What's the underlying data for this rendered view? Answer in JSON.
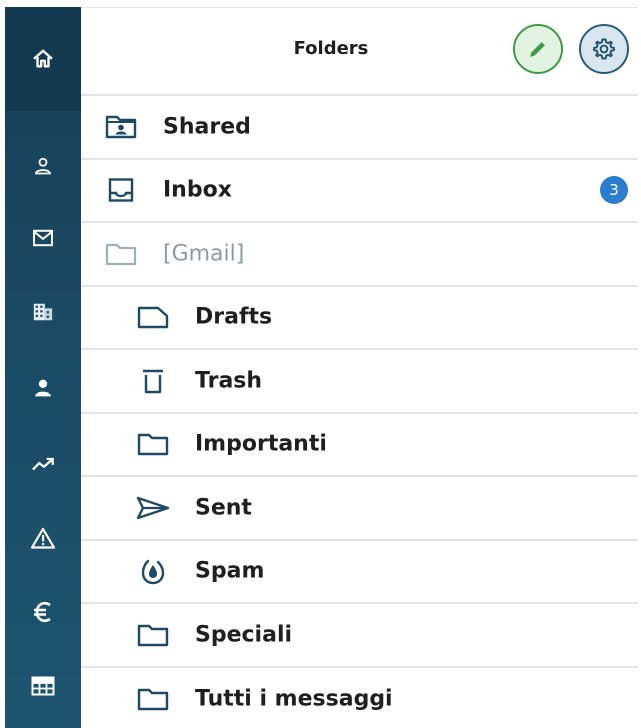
{
  "rail": {
    "items": [
      {
        "name": "home-icon"
      },
      {
        "name": "user-icon"
      },
      {
        "name": "mail-icon"
      },
      {
        "name": "building-icon"
      },
      {
        "name": "person-icon"
      },
      {
        "name": "trending-up-icon"
      },
      {
        "name": "warning-icon"
      },
      {
        "name": "euro-icon"
      },
      {
        "name": "table-icon"
      }
    ]
  },
  "header": {
    "title": "Folders",
    "edit_icon": "pencil-icon",
    "settings_icon": "gear-icon"
  },
  "folders": [
    {
      "label": "Shared",
      "icon": "shared-folder-icon",
      "level": 0
    },
    {
      "label": "Inbox",
      "icon": "inbox-icon",
      "level": 0,
      "badge": "3"
    },
    {
      "label": "[Gmail]",
      "icon": "folder-icon",
      "level": 0,
      "muted": true
    },
    {
      "label": "Drafts",
      "icon": "drafts-icon",
      "level": 1
    },
    {
      "label": "Trash",
      "icon": "trash-icon",
      "level": 1
    },
    {
      "label": "Importanti",
      "icon": "folder-icon",
      "level": 1
    },
    {
      "label": "Sent",
      "icon": "send-icon",
      "level": 1
    },
    {
      "label": "Spam",
      "icon": "spam-icon",
      "level": 1
    },
    {
      "label": "Speciali",
      "icon": "folder-icon",
      "level": 1
    },
    {
      "label": "Tutti i messaggi",
      "icon": "folder-icon",
      "level": 1
    }
  ],
  "colors": {
    "rail": "#1a4a64",
    "icon": "#1f4a66",
    "badge": "#2a7dcf",
    "edit_accent": "#3f9a45"
  }
}
